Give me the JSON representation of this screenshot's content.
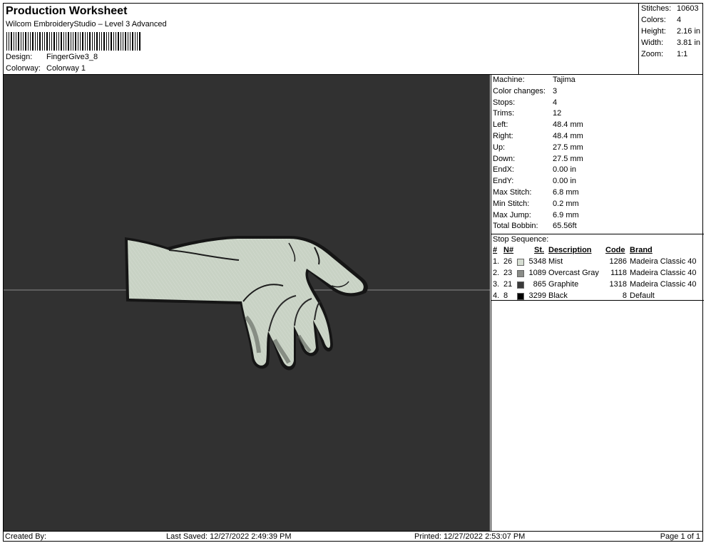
{
  "header": {
    "title": "Production Worksheet",
    "subtitle": "Wilcom EmbroideryStudio – Level 3 Advanced",
    "design_label": "Design:",
    "design_value": "FingerGive3_8",
    "colorway_label": "Colorway:",
    "colorway_value": "Colorway 1"
  },
  "stats": [
    {
      "label": "Stitches:",
      "value": "10603"
    },
    {
      "label": "Colors:",
      "value": "4"
    },
    {
      "label": "Height:",
      "value": "2.16 in"
    },
    {
      "label": "Width:",
      "value": "3.81 in"
    },
    {
      "label": "Zoom:",
      "value": "1:1"
    }
  ],
  "machine_info": [
    {
      "label": "Machine:",
      "value": "Tajima"
    },
    {
      "label": "Color changes:",
      "value": "3"
    },
    {
      "label": "Stops:",
      "value": "4"
    },
    {
      "label": "Trims:",
      "value": "12"
    },
    {
      "label": "Left:",
      "value": "48.4 mm"
    },
    {
      "label": "Right:",
      "value": "48.4 mm"
    },
    {
      "label": "Up:",
      "value": "27.5 mm"
    },
    {
      "label": "Down:",
      "value": "27.5 mm"
    },
    {
      "label": "EndX:",
      "value": "0.00 in"
    },
    {
      "label": "EndY:",
      "value": "0.00 in"
    },
    {
      "label": "Max Stitch:",
      "value": "6.8 mm"
    },
    {
      "label": "Min Stitch:",
      "value": "0.2 mm"
    },
    {
      "label": "Max Jump:",
      "value": "6.9 mm"
    },
    {
      "label": "Total Bobbin:",
      "value": "65.56ft"
    }
  ],
  "stop_sequence": {
    "title": "Stop Sequence:",
    "headers": {
      "num": "#",
      "n": "N#",
      "st": "St.",
      "desc": "Description",
      "code": "Code",
      "brand": "Brand"
    },
    "rows": [
      {
        "num": "1.",
        "n": "26",
        "color": "#d6ddd2",
        "st": "5348",
        "desc": "Mist",
        "code": "1286",
        "brand": "Madeira Classic 40"
      },
      {
        "num": "2.",
        "n": "23",
        "color": "#8a8c88",
        "st": "1089",
        "desc": "Overcast Gray",
        "code": "1118",
        "brand": "Madeira Classic 40"
      },
      {
        "num": "3.",
        "n": "21",
        "color": "#3a3a3a",
        "st": "865",
        "desc": "Graphite",
        "code": "1318",
        "brand": "Madeira Classic 40"
      },
      {
        "num": "4.",
        "n": "8",
        "color": "#000000",
        "st": "3299",
        "desc": "Black",
        "code": "8",
        "brand": "Default"
      }
    ]
  },
  "footer": {
    "created_by": "Created By:",
    "last_saved": "Last Saved: 12/27/2022 2:49:39 PM",
    "printed": "Printed: 12/27/2022 2:53:07 PM",
    "page": "Page 1 of 1"
  },
  "design_colors": {
    "background": "#313131",
    "fill": "#c8d2c4",
    "shade": "#8a9088",
    "outline": "#151515"
  }
}
